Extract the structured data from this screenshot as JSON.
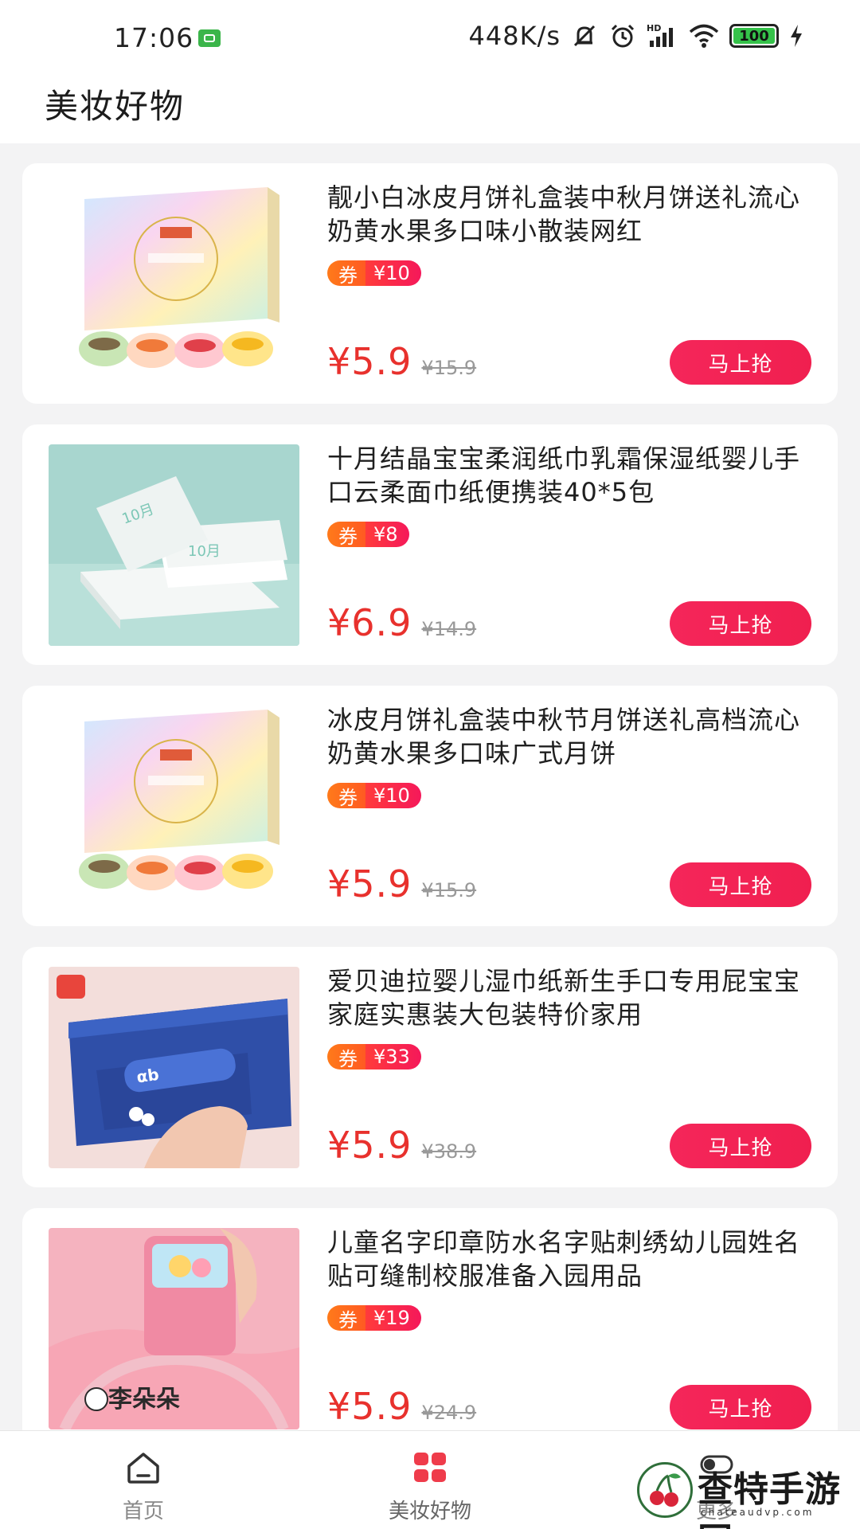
{
  "status_bar": {
    "time": "17:06",
    "network_speed": "448K/s",
    "battery": "100",
    "icons": [
      "app-notification-icon",
      "mute-icon",
      "alarm-icon",
      "hd-signal-icon",
      "wifi-icon",
      "battery-icon",
      "charging-icon"
    ]
  },
  "header": {
    "title": "美妆好物"
  },
  "products": [
    {
      "title": "靓小白冰皮月饼礼盒装中秋月饼送礼流心奶黄水果多口味小散装网红",
      "coupon_label": "券",
      "coupon_value": "¥10",
      "price": "¥5.9",
      "original_price": "¥15.9",
      "button": "马上抢"
    },
    {
      "title": "十月结晶宝宝柔润纸巾乳霜保湿纸婴儿手口云柔面巾纸便携装40*5包",
      "coupon_label": "券",
      "coupon_value": "¥8",
      "price": "¥6.9",
      "original_price": "¥14.9",
      "button": "马上抢"
    },
    {
      "title": "冰皮月饼礼盒装中秋节月饼送礼高档流心奶黄水果多口味广式月饼",
      "coupon_label": "券",
      "coupon_value": "¥10",
      "price": "¥5.9",
      "original_price": "¥15.9",
      "button": "马上抢"
    },
    {
      "title": "爱贝迪拉婴儿湿巾纸新生手口专用屁宝宝家庭实惠装大包装特价家用",
      "coupon_label": "券",
      "coupon_value": "¥33",
      "price": "¥5.9",
      "original_price": "¥38.9",
      "button": "马上抢"
    },
    {
      "title": "儿童名字印章防水名字贴刺绣幼儿园姓名贴可缝制校服准备入园用品",
      "coupon_label": "券",
      "coupon_value": "¥19",
      "price": "¥5.9",
      "original_price": "¥24.9",
      "button": "马上抢"
    }
  ],
  "bottom_nav": [
    {
      "label": "首页",
      "icon": "home-icon"
    },
    {
      "label": "美妆好物",
      "icon": "grid-icon",
      "active": true
    },
    {
      "label": "更多",
      "icon": "toggle-icon"
    }
  ],
  "watermark": {
    "text": "查特手游网",
    "url": "chateaudvp.com"
  },
  "colors": {
    "accent": "#f01f4f",
    "price": "#e8312d",
    "coupon_orange": "#ff7a1a"
  }
}
